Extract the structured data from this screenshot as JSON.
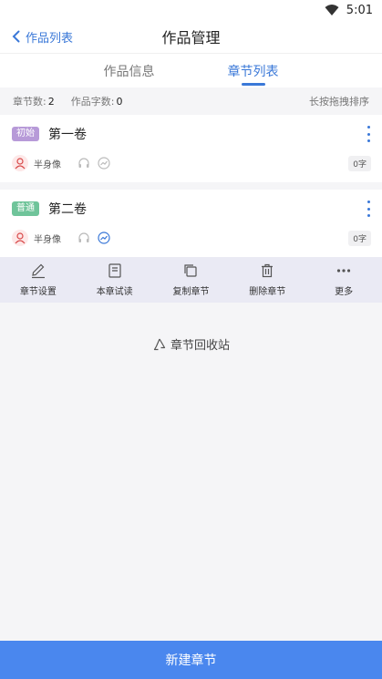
{
  "status_bar": {
    "time": "5:01"
  },
  "nav": {
    "back_label": "作品列表",
    "title": "作品管理"
  },
  "tabs": [
    {
      "label": "作品信息",
      "active": false
    },
    {
      "label": "章节列表",
      "active": true
    }
  ],
  "summary": {
    "chapter_count_label": "章节数:",
    "chapter_count": "2",
    "word_count_label": "作品字数:",
    "word_count": "0",
    "sort_hint": "长按拖拽排序"
  },
  "volumes": [
    {
      "badge": "初始",
      "badge_color": "#b79ad8",
      "title": "第一卷",
      "role": "半身像",
      "words": "0字"
    },
    {
      "badge": "普通",
      "badge_color": "#6fc49a",
      "title": "第二卷",
      "role": "半身像",
      "words": "0字"
    }
  ],
  "actions": [
    {
      "label": "章节设置",
      "icon": "pencil-icon"
    },
    {
      "label": "本章试读",
      "icon": "book-icon"
    },
    {
      "label": "复制章节",
      "icon": "copy-icon"
    },
    {
      "label": "删除章节",
      "icon": "trash-icon"
    },
    {
      "label": "更多",
      "icon": "more-icon"
    }
  ],
  "recycle_label": "章节回收站",
  "new_chapter_label": "新建章节",
  "colors": {
    "accent": "#3a78d8",
    "button": "#4a87ee"
  }
}
